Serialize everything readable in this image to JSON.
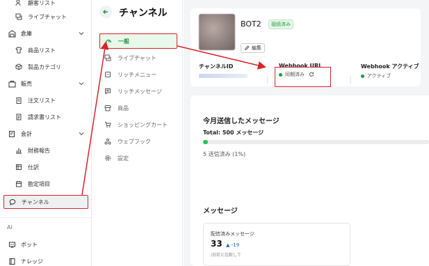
{
  "sidebar": {
    "items": [
      {
        "label": "顧客リスト",
        "icon": "users-icon"
      },
      {
        "label": "ライブチャット",
        "icon": "chat-icon"
      },
      {
        "label": "倉庫",
        "icon": "warehouse-icon"
      },
      {
        "label": "商品リスト",
        "icon": "shirt-icon"
      },
      {
        "label": "製品カテゴリ",
        "icon": "box-icon"
      },
      {
        "label": "販売",
        "icon": "sales-icon"
      },
      {
        "label": "注文リスト",
        "icon": "clipboard-icon"
      },
      {
        "label": "請求書リスト",
        "icon": "invoice-icon"
      },
      {
        "label": "会計",
        "icon": "accounting-icon"
      },
      {
        "label": "財務報告",
        "icon": "report-icon"
      },
      {
        "label": "仕訳",
        "icon": "journal-icon"
      },
      {
        "label": "勘定項目",
        "icon": "calendar-icon"
      },
      {
        "label": "チャンネル",
        "icon": "bubble-icon"
      }
    ],
    "section_ai": "AI",
    "ai_items": [
      {
        "label": "ボット",
        "icon": "bot-icon"
      },
      {
        "label": "ナレッジ",
        "icon": "book-icon"
      }
    ]
  },
  "subnav": {
    "title": "チャンネル",
    "items": [
      {
        "label": "一般"
      },
      {
        "label": "ライブチャット"
      },
      {
        "label": "リッチメニュー"
      },
      {
        "label": "リッチメッセージ"
      },
      {
        "label": "商品"
      },
      {
        "label": "ショッピングカート"
      },
      {
        "label": "ウェブフック"
      },
      {
        "label": "設定"
      }
    ]
  },
  "bot": {
    "name": "BOT2",
    "status_badge": "接続済み",
    "edit_label": "編集",
    "channel_id_label": "チャンネルID",
    "webhook_url_label": "Webhook URL",
    "webhook_url_status": "同期済み",
    "webhook_active_label": "Webhook アクティブ",
    "webhook_active_status": "アクティブ"
  },
  "stats": {
    "title": "今月送信したメッセージ",
    "total": "Total: 500 メッセージ",
    "progress_fraction": 0.01,
    "sent": "5 送信済み (1%)"
  },
  "messages": {
    "title": "メッセージ",
    "card_label": "配信済みメッセージ",
    "card_value": "33",
    "card_delta": "-19",
    "card_note": "/日前と比較して"
  },
  "colors": {
    "accent_green": "#1c9b3c",
    "annotation_red": "#d8232a"
  }
}
